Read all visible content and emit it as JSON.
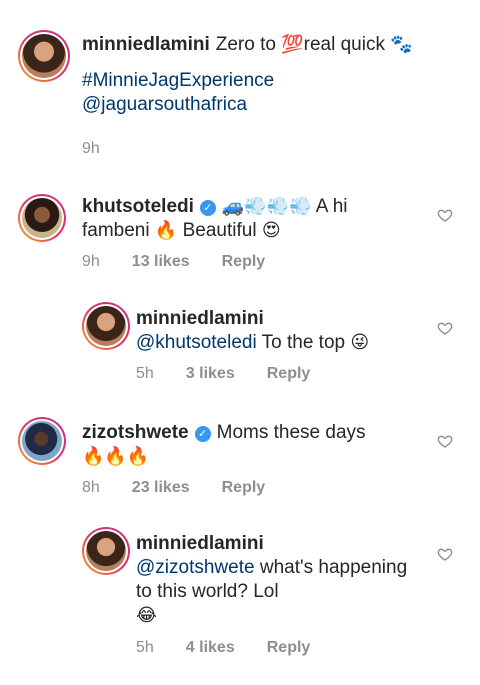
{
  "caption": {
    "username": "minniedlamini",
    "text_before": "Zero to",
    "emoji_100": "💯",
    "text_after": "real quick",
    "emoji_paws": "🐾",
    "hashtag": "#MinnieJagExperience",
    "mention": "@jaguarsouthafrica",
    "time": "9h"
  },
  "comments": [
    {
      "username": "khutsoteledi",
      "verified": true,
      "emojis_prefix": "🚙💨💨💨",
      "text": "A hi fambeni",
      "emoji_fire": "🔥",
      "text2": "Beautiful",
      "emoji_end": "😍",
      "time": "9h",
      "likes": "13 likes",
      "reply": "Reply"
    },
    {
      "username": "minniedlamini",
      "mention": "@khutsoteledi",
      "text": "To the top",
      "emoji_end": "😜",
      "time": "5h",
      "likes": "3 likes",
      "reply": "Reply"
    },
    {
      "username": "zizotshwete",
      "verified": true,
      "text": "Moms these days",
      "emojis_end": "🔥🔥🔥",
      "time": "8h",
      "likes": "23 likes",
      "reply": "Reply"
    },
    {
      "username": "minniedlamini",
      "mention": "@zizotshwete",
      "text": "what's happening to this world? Lol",
      "emoji_end": "😂",
      "time": "5h",
      "likes": "4 likes",
      "reply": "Reply"
    }
  ],
  "icons": {
    "verified": "✓",
    "heart": "heart-outline-icon"
  }
}
